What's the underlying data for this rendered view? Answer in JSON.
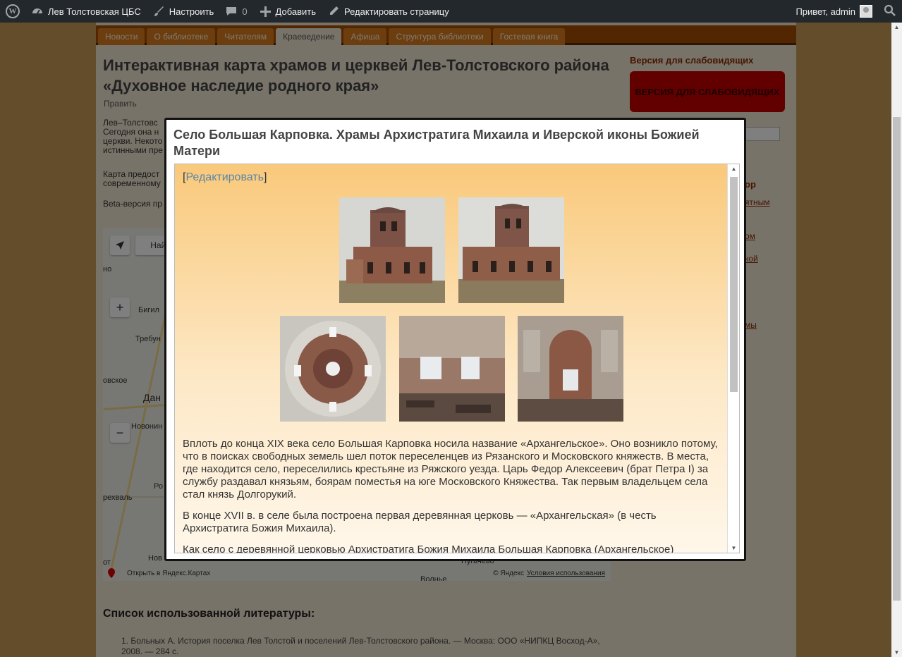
{
  "adminbar": {
    "site_name": "Лев Толстовская ЦБС",
    "customize": "Настроить",
    "comments_count": "0",
    "add_new": "Добавить",
    "edit_page": "Редактировать страницу",
    "greeting": "Привет, admin"
  },
  "nav": {
    "tabs": [
      "Новости",
      "О библиотеке",
      "Читателям",
      "Краеведение",
      "Афиша",
      "Структура библиотеки",
      "Гостевая книга"
    ],
    "active_index": 3
  },
  "page": {
    "title": "Интерактивная карта храмов и церквей Лев-Толстовского района «Духовное наследие родного края»",
    "edit": "Править",
    "intro_lines": [
      "Лев–Толстовс",
      "Сегодня она н",
      "церкви. Некото",
      "истинными пре"
    ],
    "para2_lines": [
      "Карта предост",
      "современному"
    ],
    "beta": "Beta-версия пр"
  },
  "map": {
    "find_button": "Найт",
    "labels": [
      "но",
      "Бигил",
      "Требун",
      "овское",
      "Дан",
      "Новонин",
      "Ро",
      "рехваль",
      "Нов",
      "от",
      "Волнье",
      "Пугачёво"
    ],
    "open_link": "Открыть в Яндекс.Картах",
    "copyright": "© Яндекс",
    "terms": "Условия использования"
  },
  "sidebar": {
    "heading": "Версия для слабовидящих",
    "button": "Версия для слабовидящих",
    "frag_heading": "ор",
    "links": [
      "ятным",
      "ом",
      "кой",
      "мы"
    ]
  },
  "literature": {
    "heading": "Список использованной литературы:",
    "item1": "1. Больных А. История поселка Лев Толстой и поселений Лев-Толстовского района. — Москва: ООО «НИПКЦ Восход-А», 2008. — 284 с."
  },
  "modal": {
    "title": "Село Большая Карповка. Храмы Архистратига Михаила и Иверской иконы Божией Матери",
    "edit_link": "Редактировать",
    "paragraphs": [
      "Вплоть до конца XIX века село Большая Карповка носила название «Архангельское». Оно возникло потому, что в поисках свободных земель шел поток переселенцев из Рязанского и Московского княжеств. В места, где находится село, переселились крестьяне из Ряжского уезда. Царь Федор Алексеевич (брат Петра I) за службу раздавал князьям, боярам поместья на юге Московского Княжества. Так первым владельцем села стал князь Долгорукий.",
      "В конце XVII в. в селе была построена первая деревянная церковь — «Архангельская» (в честь Архистратига Божия Михаила).",
      "Как село с деревянной церковью Архистратига Божия Михаила Большая Карповка (Архангельское)"
    ]
  },
  "colors": {
    "adminbar": "#23282d",
    "nav": "#a34c00",
    "accent_red": "#c40000",
    "link": "#5b86a6"
  }
}
